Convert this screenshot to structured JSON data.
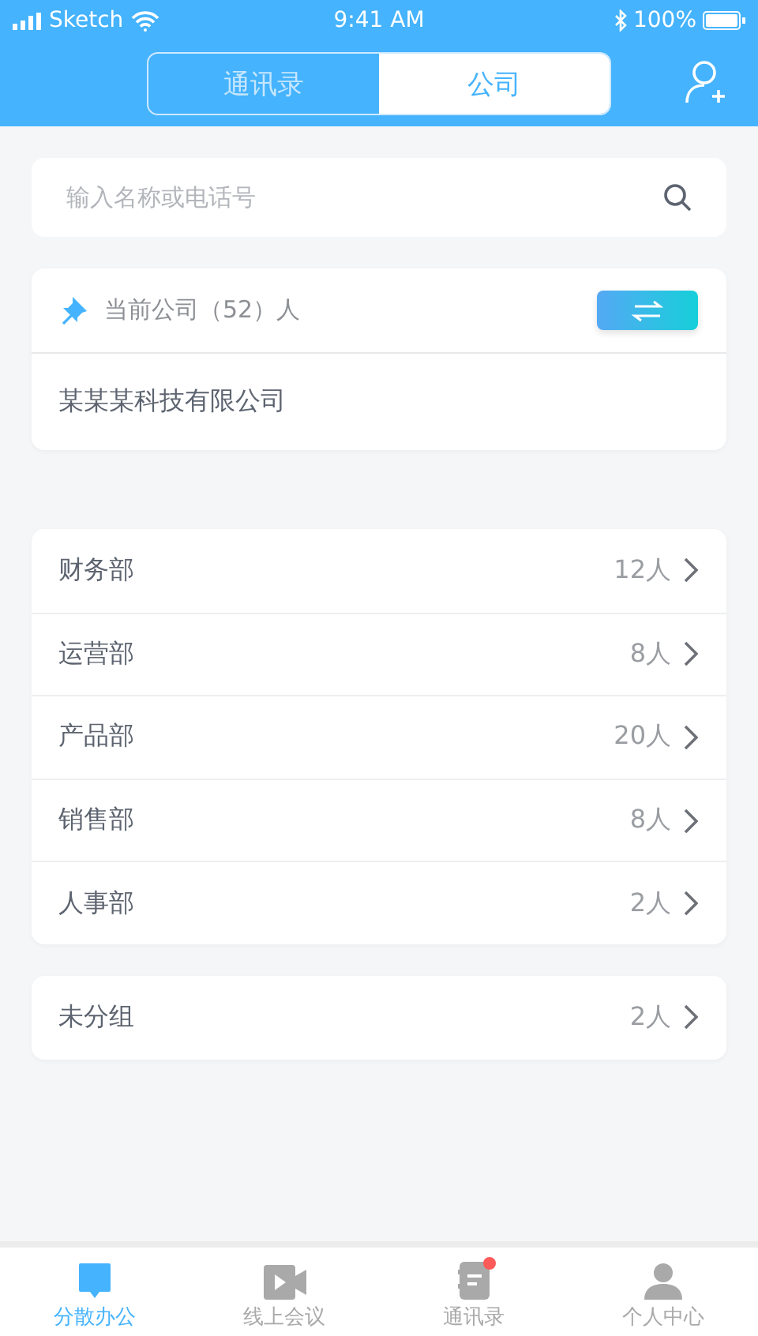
{
  "status_bar": {
    "carrier": "Sketch",
    "time": "9:41 AM",
    "battery": "100%"
  },
  "header": {
    "segments": [
      {
        "label": "通讯录",
        "selected": false
      },
      {
        "label": "公司",
        "selected": true
      }
    ]
  },
  "search": {
    "placeholder": "输入名称或电话号"
  },
  "current_company": {
    "label": "当前公司（52）人",
    "name": "某某某科技有限公司"
  },
  "departments": [
    {
      "name": "财务部",
      "count": "12人"
    },
    {
      "name": "运营部",
      "count": "8人"
    },
    {
      "name": "产品部",
      "count": "20人"
    },
    {
      "name": "销售部",
      "count": "8人"
    },
    {
      "name": "人事部",
      "count": "2人"
    }
  ],
  "ungrouped": {
    "name": "未分组",
    "count": "2人"
  },
  "tab_bar": [
    {
      "kind": "chat",
      "label": "分散办公",
      "selected": true,
      "badge": false
    },
    {
      "kind": "video",
      "label": "线上会议",
      "selected": false,
      "badge": false
    },
    {
      "kind": "book",
      "label": "通讯录",
      "selected": false,
      "badge": true
    },
    {
      "kind": "person",
      "label": "个人中心",
      "selected": false,
      "badge": false
    }
  ]
}
